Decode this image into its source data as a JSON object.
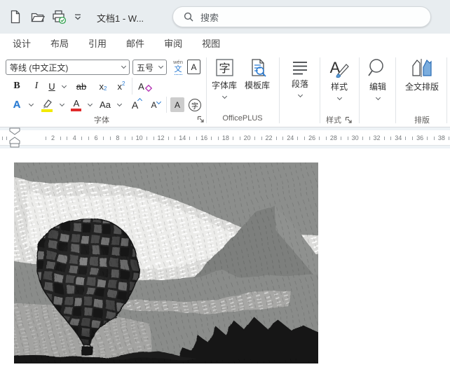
{
  "titlebar": {
    "title": "文档1 - W...",
    "search_label": "搜索"
  },
  "tabs": [
    "设计",
    "布局",
    "引用",
    "邮件",
    "审阅",
    "视图"
  ],
  "ribbon": {
    "font": {
      "group_label": "字体",
      "font_name": "等线 (中文正文)",
      "font_size": "五号",
      "phonetic_top": "wén",
      "phonetic_bottom": "文",
      "char_border": "A",
      "bold": "B",
      "italic": "I",
      "underline": "U",
      "strikethrough": "ab",
      "sub_base": "x",
      "sub_small": "2",
      "sup_base": "x",
      "sup_small": "2",
      "clear_formatting": "A",
      "text_effects": "A",
      "font_color": "A",
      "change_case": "Aa",
      "grow_font": "A",
      "shrink_font": "A",
      "char_shading": "A",
      "enclose_char": "字"
    },
    "officeplus": {
      "group_label": "OfficePLUS",
      "font_library": "字体库",
      "font_library_icon_char": "字",
      "template_library": "模板库"
    },
    "paragraph": {
      "button_label": "段落"
    },
    "styles": {
      "group_label": "样式",
      "button_label": "样式"
    },
    "editing": {
      "button_label": "编辑"
    },
    "paiban": {
      "group_label": "排版",
      "button_label": "全文排版"
    }
  },
  "ruler": {
    "numbers": [
      2,
      4,
      6,
      8,
      10,
      12,
      14,
      16,
      18,
      20,
      22,
      24,
      26,
      28,
      30,
      32,
      34,
      36,
      38
    ]
  },
  "colors": {
    "titlebar_bg": "#e8edf0",
    "accent_blue": "#2b7cd3",
    "highlight_yellow": "#f2ea00",
    "font_color_red": "#e02b2b",
    "clear_format_magenta": "#b63ab6",
    "check_green": "#2fa04c",
    "label_gray": "#605e5c"
  }
}
